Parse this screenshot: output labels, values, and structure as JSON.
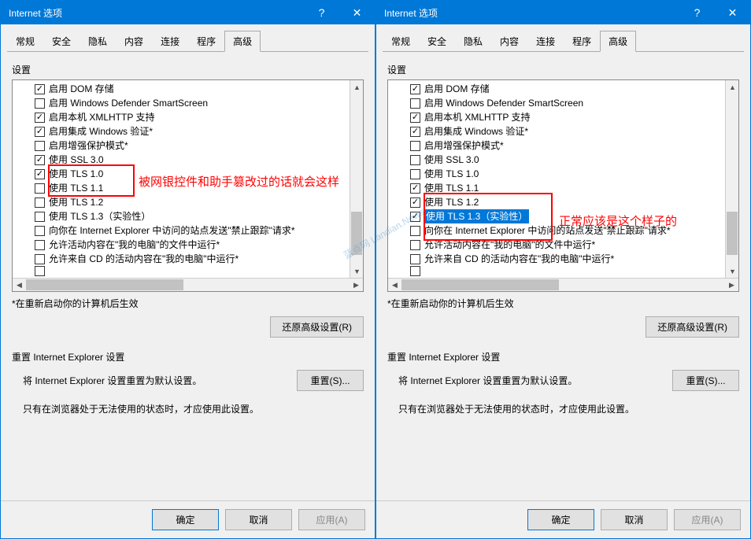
{
  "title": "Internet 选项",
  "tabs": {
    "general": "常规",
    "security": "安全",
    "privacy": "隐私",
    "content": "内容",
    "connections": "连接",
    "programs": "程序",
    "advanced": "高级"
  },
  "section_settings": "设置",
  "left_items": [
    {
      "checked": true,
      "label": "启用 DOM 存储"
    },
    {
      "checked": false,
      "label": "启用 Windows Defender SmartScreen"
    },
    {
      "checked": true,
      "label": "启用本机 XMLHTTP 支持"
    },
    {
      "checked": true,
      "label": "启用集成 Windows 验证*"
    },
    {
      "checked": false,
      "label": "启用增强保护模式*"
    },
    {
      "checked": true,
      "label": "使用 SSL 3.0"
    },
    {
      "checked": true,
      "label": "使用 TLS 1.0"
    },
    {
      "checked": false,
      "label": "使用 TLS 1.1"
    },
    {
      "checked": false,
      "label": "使用 TLS 1.2"
    },
    {
      "checked": false,
      "label": "使用 TLS 1.3（实验性）"
    },
    {
      "checked": false,
      "label": "向你在 Internet Explorer 中访问的站点发送\"禁止跟踪\"请求*"
    },
    {
      "checked": false,
      "label": "允许活动内容在\"我的电脑\"的文件中运行*"
    },
    {
      "checked": false,
      "label": "允许来自 CD 的活动内容在\"我的电脑\"中运行*"
    }
  ],
  "right_items": [
    {
      "checked": true,
      "label": "启用 DOM 存储"
    },
    {
      "checked": false,
      "label": "启用 Windows Defender SmartScreen"
    },
    {
      "checked": true,
      "label": "启用本机 XMLHTTP 支持"
    },
    {
      "checked": true,
      "label": "启用集成 Windows 验证*"
    },
    {
      "checked": false,
      "label": "启用增强保护模式*"
    },
    {
      "checked": false,
      "label": "使用 SSL 3.0"
    },
    {
      "checked": false,
      "label": "使用 TLS 1.0"
    },
    {
      "checked": true,
      "label": "使用 TLS 1.1"
    },
    {
      "checked": true,
      "label": "使用 TLS 1.2"
    },
    {
      "checked": true,
      "label": "使用 TLS 1.3（实验性）",
      "selected": true
    },
    {
      "checked": false,
      "label": "向你在 Internet Explorer 中访问的站点发送\"禁止跟踪\"请求*"
    },
    {
      "checked": false,
      "label": "允许活动内容在\"我的电脑\"的文件中运行*"
    },
    {
      "checked": false,
      "label": "允许来自 CD 的活动内容在\"我的电脑\"中运行*"
    }
  ],
  "note": "*在重新启动你的计算机后生效",
  "restore_btn": "还原高级设置(R)",
  "reset_title": "重置 Internet Explorer 设置",
  "reset_text": "将 Internet Explorer 设置重置为默认设置。",
  "reset_btn": "重置(S)...",
  "info_text": "只有在浏览器处于无法使用的状态时，才应使用此设置。",
  "footer": {
    "ok": "确定",
    "cancel": "取消",
    "apply": "应用(A)"
  },
  "annotations": {
    "left": "被网银控件和助手篡改过的话就会这样",
    "right": "正常应该是这个样子的"
  },
  "watermark": "蓝点网\nLandian.News"
}
